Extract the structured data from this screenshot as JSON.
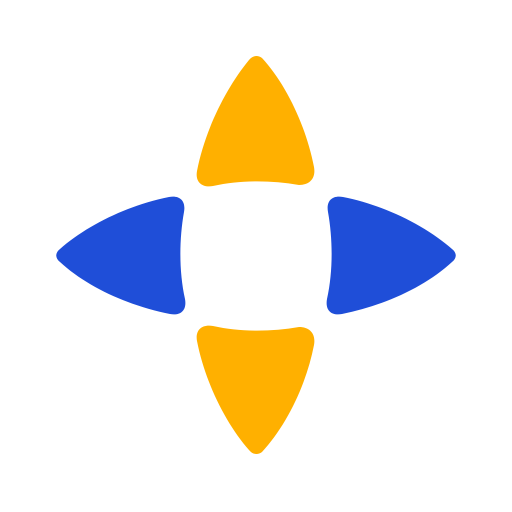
{
  "logo": {
    "icon": "compass-star-logo-icon",
    "colors": {
      "background": "#ffffff",
      "vertical_petals": "#FFB000",
      "horizontal_petals": "#1F4ED8"
    }
  }
}
